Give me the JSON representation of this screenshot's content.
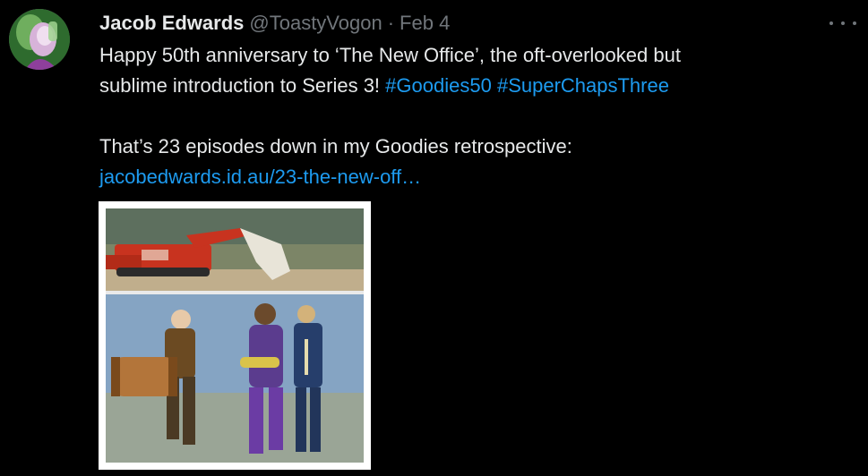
{
  "tweet": {
    "author_name": "Jacob Edwards",
    "handle": "@ToastyVogon",
    "separator": "·",
    "date": "Feb 4",
    "more_icon": "more-horizontal-icon",
    "text_line1": "Happy 50th anniversary to ‘The New Office’, the oft-overlooked but",
    "text_line2_plain": "sublime introduction to Series 3! ",
    "hashtag1": "#Goodies50",
    "hashtag2": "#SuperChapsThree",
    "text_line3": "That’s 23 episodes down in my Goodies retrospective:",
    "link_text": "jacobedwards.id.au/23-the-new-off…"
  },
  "colors": {
    "background": "#000000",
    "text": "#e7e9ea",
    "secondary": "#71767b",
    "accent": "#1d9bf0"
  }
}
